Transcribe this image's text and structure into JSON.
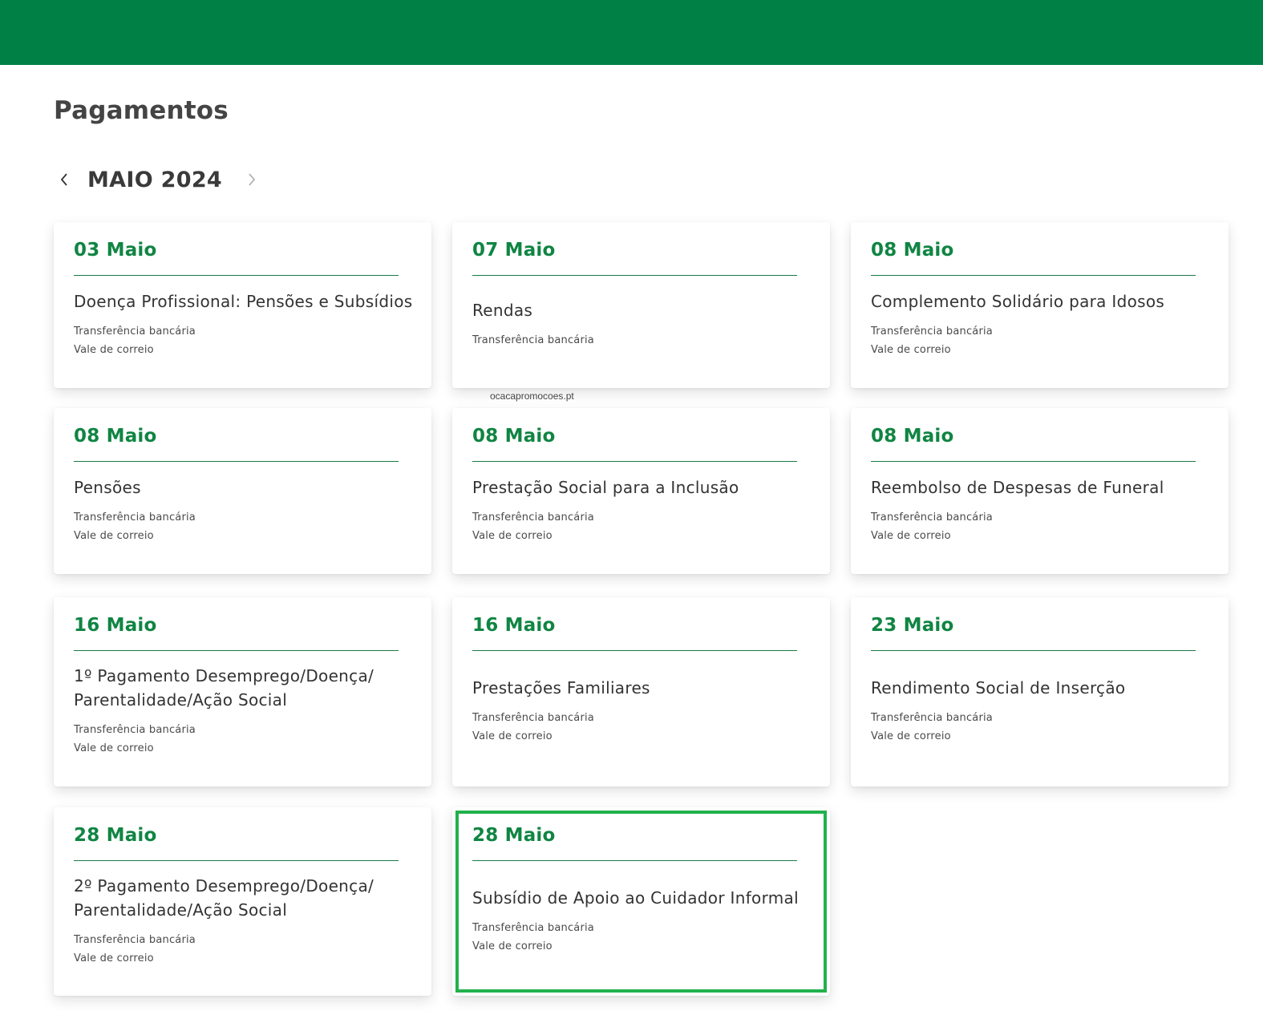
{
  "page": {
    "title": "Pagamentos",
    "month": "MAIO 2024",
    "watermark": "ocacapromocoes.pt",
    "accent_color": "#018046",
    "highlight_color": "#22b14c"
  },
  "cards": [
    {
      "date": "03 Maio",
      "title": "Doença Profissional: Pensões e Subsídios",
      "methods": [
        "Transferência bancária",
        "Vale de correio"
      ]
    },
    {
      "date": "07 Maio",
      "title": "Rendas",
      "methods": [
        "Transferência bancária"
      ]
    },
    {
      "date": "08 Maio",
      "title": "Complemento Solidário para Idosos",
      "methods": [
        "Transferência bancária",
        "Vale de correio"
      ]
    },
    {
      "date": "08 Maio",
      "title": "Pensões",
      "methods": [
        "Transferência bancária",
        "Vale de correio"
      ]
    },
    {
      "date": "08 Maio",
      "title": "Prestação Social para a Inclusão",
      "methods": [
        "Transferência bancária",
        "Vale de correio"
      ]
    },
    {
      "date": "08 Maio",
      "title": "Reembolso de Despesas de Funeral",
      "methods": [
        "Transferência bancária",
        "Vale de correio"
      ]
    },
    {
      "date": "16 Maio",
      "title": "1º Pagamento Desemprego/Doença/ Parentalidade/Ação Social",
      "methods": [
        "Transferência bancária",
        "Vale de correio"
      ]
    },
    {
      "date": "16 Maio",
      "title": "Prestações Familiares",
      "methods": [
        "Transferência bancária",
        "Vale de correio"
      ]
    },
    {
      "date": "23 Maio",
      "title": "Rendimento Social de Inserção",
      "methods": [
        "Transferência bancária",
        "Vale de correio"
      ]
    },
    {
      "date": "28 Maio",
      "title": "2º Pagamento Desemprego/Doença/ Parentalidade/Ação Social",
      "methods": [
        "Transferência bancária",
        "Vale de correio"
      ]
    },
    {
      "date": "28 Maio",
      "title": "Subsídio de Apoio ao Cuidador Informal",
      "methods": [
        "Transferência bancária",
        "Vale de correio"
      ]
    }
  ]
}
